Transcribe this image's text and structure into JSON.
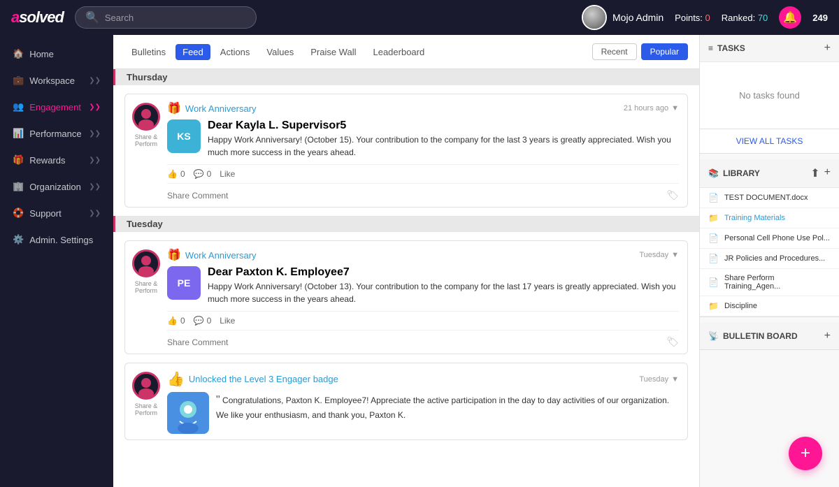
{
  "app": {
    "logo": "asolved",
    "logo_highlight": "a"
  },
  "topnav": {
    "search_placeholder": "Search",
    "user_name": "Mojo Admin",
    "points_label": "Points:",
    "points_value": "0",
    "ranked_label": "Ranked:",
    "ranked_value": "70",
    "notif_count": "249"
  },
  "sidebar": {
    "items": [
      {
        "label": "Home",
        "icon": "🏠",
        "active": false
      },
      {
        "label": "Workspace",
        "icon": "💼",
        "active": false,
        "has_chevron": true
      },
      {
        "label": "Engagement",
        "icon": "👥",
        "active": true,
        "has_chevron": true
      },
      {
        "label": "Performance",
        "icon": "📊",
        "active": false,
        "has_chevron": true
      },
      {
        "label": "Rewards",
        "icon": "🎁",
        "active": false,
        "has_chevron": true
      },
      {
        "label": "Organization",
        "icon": "🏢",
        "active": false,
        "has_chevron": true
      },
      {
        "label": "Support",
        "icon": "🛟",
        "active": false,
        "has_chevron": true
      },
      {
        "label": "Admin. Settings",
        "icon": "⚙️",
        "active": false
      }
    ]
  },
  "feed_tabs": {
    "tabs": [
      {
        "label": "Bulletins",
        "active": false
      },
      {
        "label": "Feed",
        "active": true
      },
      {
        "label": "Actions",
        "active": false
      },
      {
        "label": "Values",
        "active": false
      },
      {
        "label": "Praise Wall",
        "active": false
      },
      {
        "label": "Leaderboard",
        "active": false
      }
    ],
    "view_tabs": [
      {
        "label": "Recent",
        "active": false
      },
      {
        "label": "Popular",
        "active": true
      }
    ]
  },
  "posts": {
    "thursday_label": "Thursday",
    "tuesday_label": "Tuesday",
    "post1": {
      "type": "Work Anniversary",
      "time": "21 hours ago",
      "avatar_initials": "KS",
      "avatar_bg": "#3cb3d6",
      "user": "Dear Kayla L. Supervisor5",
      "message": "Happy Work Anniversary! (October 15). Your contribution to the company for the last 3 years is greatly appreciated. Wish you much more success in the years ahead.",
      "likes": "0",
      "comments": "0",
      "like_label": "Like",
      "share_placeholder": "Share Comment"
    },
    "post2": {
      "type": "Work Anniversary",
      "time": "Tuesday",
      "avatar_initials": "PE",
      "avatar_bg": "#7b68ee",
      "user": "Dear Paxton K. Employee7",
      "message": "Happy Work Anniversary! (October 13). Your contribution to the company for the last 17 years is greatly appreciated. Wish you much more success in the years ahead.",
      "likes": "0",
      "comments": "0",
      "like_label": "Like",
      "share_placeholder": "Share Comment"
    },
    "post3": {
      "type": "Unlocked the Level 3 Engager badge",
      "time": "Tuesday",
      "user": "Congratulations, Paxton K. Employee7! Appreciate the active participation in the day to day activities of our organization. We like your enthusiasm, and thank you, Paxton K."
    },
    "share_label": "Share & Perform",
    "share_label2": "Share & Perform"
  },
  "tasks": {
    "header": "TASKS",
    "empty_text": "No tasks found",
    "view_all": "VIEW ALL TASKS"
  },
  "library": {
    "header": "LIBRARY",
    "items": [
      {
        "type": "file",
        "label": "TEST DOCUMENT.docx"
      },
      {
        "type": "folder",
        "label": "Training Materials"
      },
      {
        "type": "file",
        "label": "Personal Cell Phone Use Pol..."
      },
      {
        "type": "file",
        "label": "JR Policies and Procedures..."
      },
      {
        "type": "file",
        "label": "Share Perform Training_Agen..."
      },
      {
        "type": "folder",
        "label": "Discipline"
      }
    ]
  },
  "bulletin": {
    "header": "BULLETIN BOARD"
  },
  "fab": {
    "icon": "+"
  }
}
